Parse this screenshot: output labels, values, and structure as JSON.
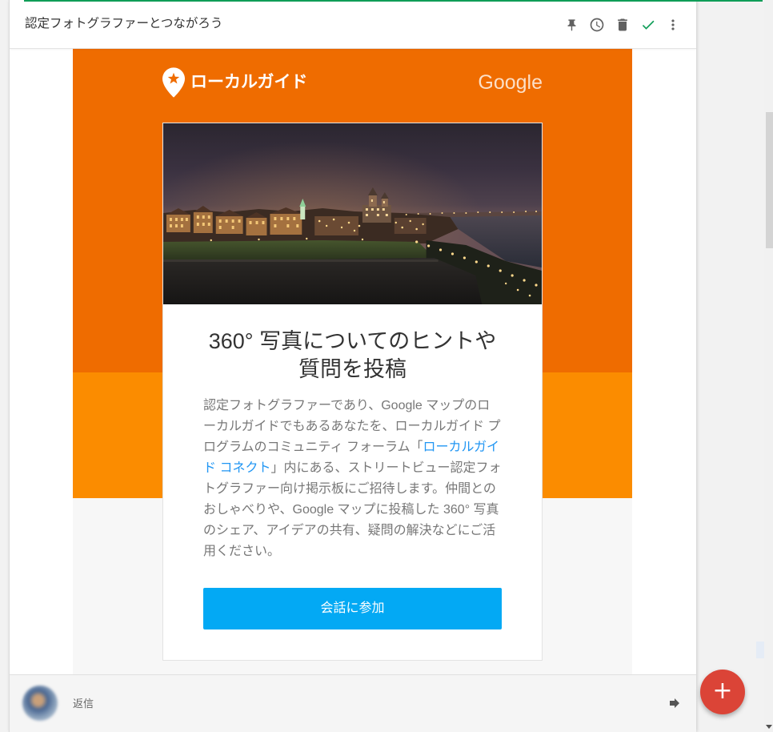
{
  "app": {
    "accent_color": "#0f9d58"
  },
  "header": {
    "subject": "認定フォトグラファーとつながろう",
    "actions": [
      {
        "icon": "pin-icon"
      },
      {
        "icon": "snooze-clock-icon"
      },
      {
        "icon": "trash-icon"
      },
      {
        "icon": "done-check-icon",
        "color": "#0f9d58"
      },
      {
        "icon": "more-vert-icon"
      }
    ]
  },
  "email": {
    "colors": {
      "hero_orange": "#ef6c00",
      "band_orange": "#fb8c00",
      "footer_gray": "#f7f7f7",
      "link_blue": "#2196f3",
      "button_blue": "#03a9f4"
    },
    "brand": {
      "logo_icon": "local-guides-pin-icon",
      "program_name": "ローカルガイド",
      "partner_wordmark": "Google"
    },
    "headline": [
      "360° 写真についてのヒントや",
      "質問を投稿"
    ],
    "body": {
      "before_link": "認定フォトグラファーであり、Google マップのローカルガイドでもあるあなたを、ローカルガイド プログラムのコミュニティ フォーラム「",
      "link_text": "ローカルガイド コネクト",
      "after_link": "」内にある、ストリートビュー認定フォトグラファー向け掲示板にご招待します。仲間とのおしゃべりや、Google マップに投稿した 360° 写真のシェア、アイデアの共有、疑問の解決などにご活用ください。"
    },
    "cta": {
      "label": "会話に参加"
    }
  },
  "reply_bar": {
    "label": "返信",
    "send_icon": "forward-arrow-icon"
  },
  "fab": {
    "label": "+",
    "color": "#db4437"
  }
}
